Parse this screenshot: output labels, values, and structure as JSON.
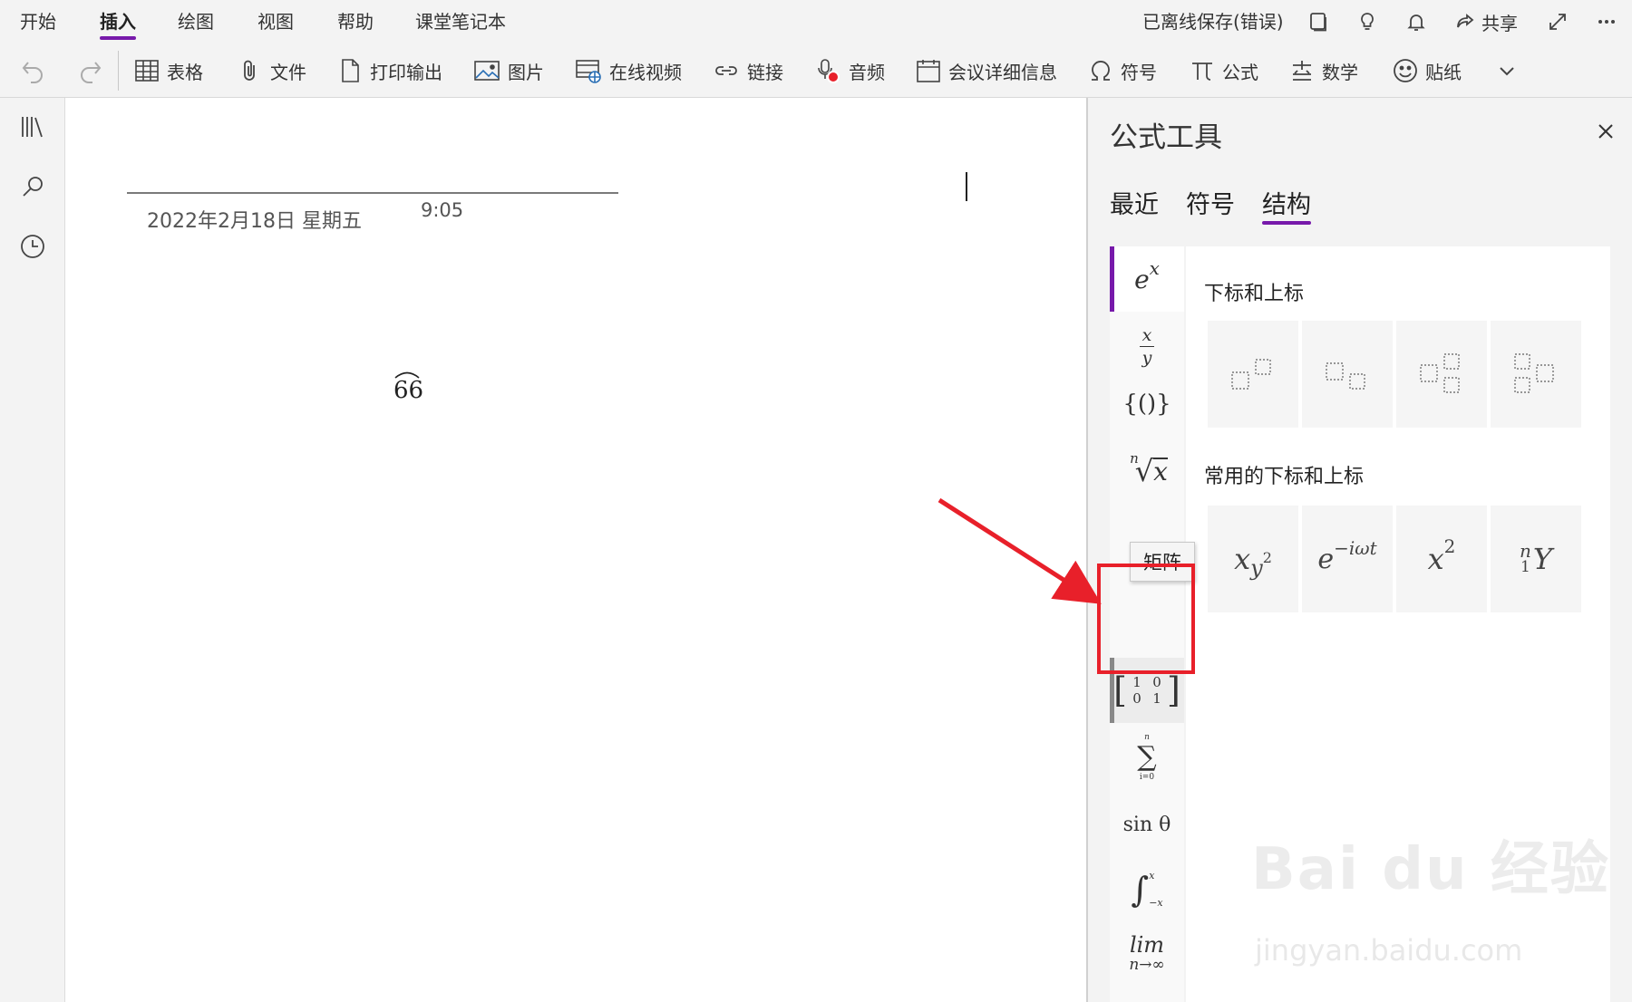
{
  "menu": {
    "tabs": [
      {
        "label": "开始",
        "active": false
      },
      {
        "label": "插入",
        "active": true
      },
      {
        "label": "绘图",
        "active": false
      },
      {
        "label": "视图",
        "active": false
      },
      {
        "label": "帮助",
        "active": false
      },
      {
        "label": "课堂笔记本",
        "active": false
      }
    ],
    "status": "已离线保存(错误)",
    "share_label": "共享",
    "icons": [
      "notebook-icon",
      "lightbulb-icon",
      "bell-icon",
      "share-icon",
      "expand-icon",
      "more-icon"
    ]
  },
  "ribbon": {
    "items": [
      {
        "label": "表格",
        "icon": "table-icon"
      },
      {
        "label": "文件",
        "icon": "paperclip-icon"
      },
      {
        "label": "打印输出",
        "icon": "document-icon"
      },
      {
        "label": "图片",
        "icon": "picture-icon"
      },
      {
        "label": "在线视频",
        "icon": "online-video-icon"
      },
      {
        "label": "链接",
        "icon": "link-icon"
      },
      {
        "label": "音频",
        "icon": "audio-icon"
      },
      {
        "label": "会议详细信息",
        "icon": "calendar-icon"
      },
      {
        "label": "符号",
        "icon": "omega-icon"
      },
      {
        "label": "公式",
        "icon": "pi-icon"
      },
      {
        "label": "数学",
        "icon": "math-icon"
      },
      {
        "label": "贴纸",
        "icon": "smiley-icon"
      }
    ]
  },
  "page": {
    "date": "2022年2月18日 星期五",
    "time": "9:05",
    "equation": "66"
  },
  "panel": {
    "title": "公式工具",
    "tabs": [
      {
        "label": "最近",
        "active": false
      },
      {
        "label": "符号",
        "active": false
      },
      {
        "label": "结构",
        "active": true
      }
    ],
    "tooltip": "矩阵",
    "section1_title": "下标和上标",
    "section2_title": "常用的下标和上标",
    "common_tiles": [
      {
        "base": "x",
        "sub": "y",
        "sup": "2"
      },
      {
        "base": "e",
        "sup": "−iωt"
      },
      {
        "base": "x",
        "sup": "2"
      },
      {
        "presup": "n",
        "presub": "1",
        "base": "Y"
      }
    ],
    "categories": {
      "scripts": {
        "base": "e",
        "sup": "x"
      },
      "fraction": {
        "num": "x",
        "den": "y"
      },
      "brackets": "{()}",
      "radical": {
        "index": "n",
        "radicand": "x"
      },
      "matrix": {
        "r1c1": "1",
        "r1c2": "0",
        "r2c1": "0",
        "r2c2": "1"
      },
      "sum": {
        "sup": "n",
        "sub": "i=0",
        "op": "∑"
      },
      "function": "sin θ",
      "integral": {
        "sup": "x",
        "sub": "−x"
      },
      "limit": {
        "top": "lim",
        "bottom": "n→∞"
      },
      "operator": "≙"
    }
  },
  "watermark": {
    "main": "Bai du 经验",
    "sub": "jingyan.baidu.com"
  },
  "colors": {
    "accent": "#7719aa",
    "annotation_red": "#e8202a"
  }
}
